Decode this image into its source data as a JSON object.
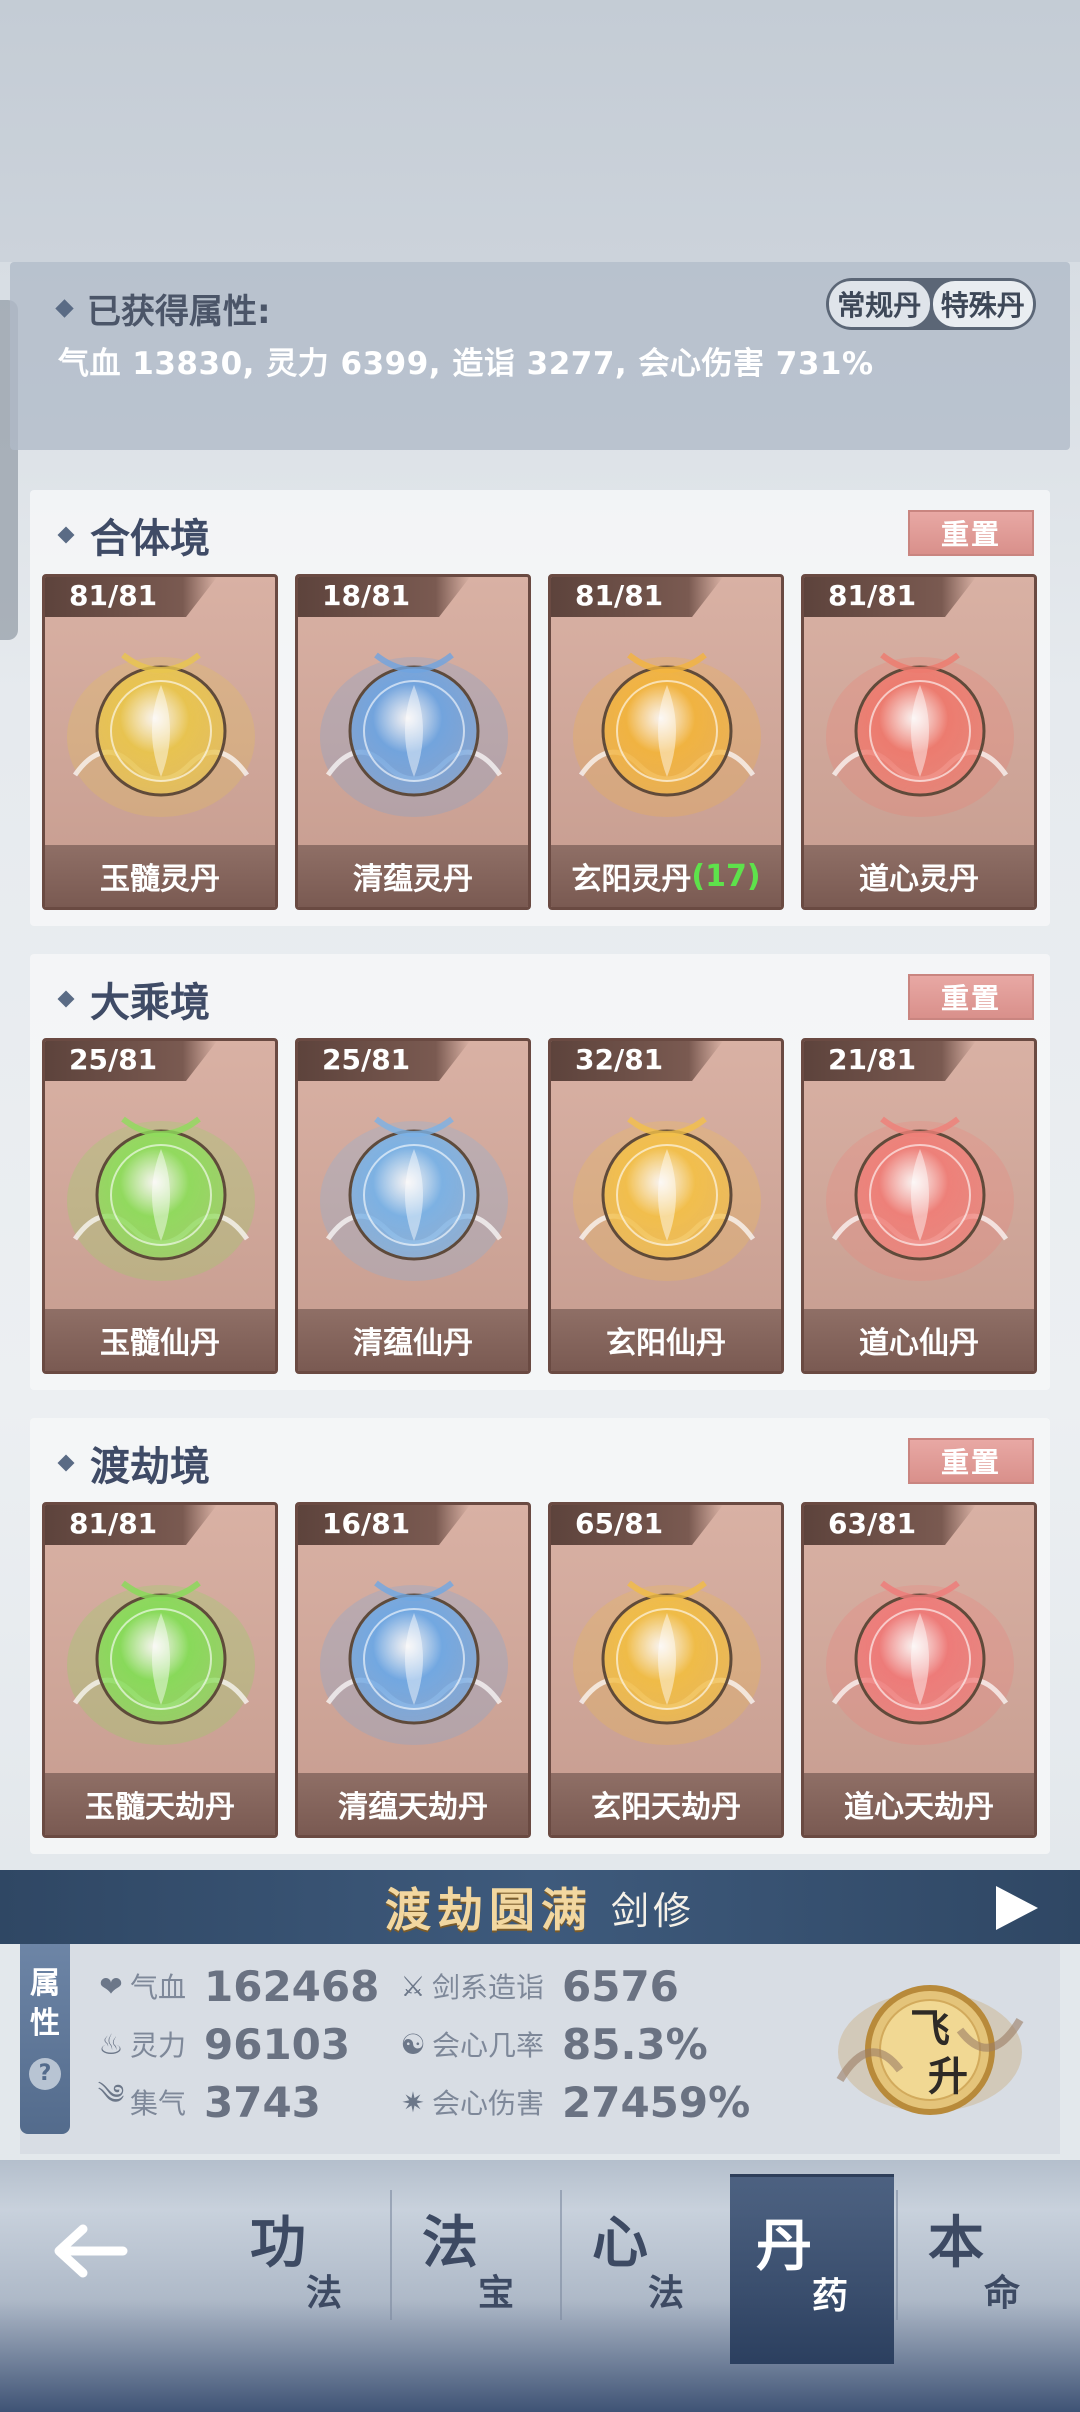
{
  "attributes_header": {
    "title": "已获得属性:",
    "summary": "气血 13830, 灵力 6399, 造诣 3277, 会心伤害 731%",
    "toggle": {
      "regular": "常规丹",
      "special": "特殊丹",
      "selected": "常规丹"
    }
  },
  "realms": [
    {
      "title": "合体境",
      "reset_label": "重置",
      "pills": [
        {
          "count": "81/81",
          "name": "玉髓灵丹",
          "bonus": "",
          "color": "#e9c54e"
        },
        {
          "count": "18/81",
          "name": "清蕴灵丹",
          "bonus": "",
          "color": "#6fa4e0"
        },
        {
          "count": "81/81",
          "name": "玄阳灵丹",
          "bonus": "(17)",
          "color": "#f2b43e"
        },
        {
          "count": "81/81",
          "name": "道心灵丹",
          "bonus": "",
          "color": "#ee7a6e"
        }
      ]
    },
    {
      "title": "大乘境",
      "reset_label": "重置",
      "pills": [
        {
          "count": "25/81",
          "name": "玉髓仙丹",
          "bonus": "",
          "color": "#8fdc5c"
        },
        {
          "count": "25/81",
          "name": "清蕴仙丹",
          "bonus": "",
          "color": "#7ab2e6"
        },
        {
          "count": "32/81",
          "name": "玄阳仙丹",
          "bonus": "",
          "color": "#f3c04a"
        },
        {
          "count": "21/81",
          "name": "道心仙丹",
          "bonus": "",
          "color": "#ef7f78"
        }
      ]
    },
    {
      "title": "渡劫境",
      "reset_label": "重置",
      "pills": [
        {
          "count": "81/81",
          "name": "玉髓天劫丹",
          "bonus": "",
          "color": "#86dc58"
        },
        {
          "count": "16/81",
          "name": "清蕴天劫丹",
          "bonus": "",
          "color": "#6fa8e4"
        },
        {
          "count": "65/81",
          "name": "玄阳天劫丹",
          "bonus": "",
          "color": "#f1bd45"
        },
        {
          "count": "63/81",
          "name": "道心天劫丹",
          "bonus": "",
          "color": "#ef7a78"
        }
      ]
    }
  ],
  "banner": {
    "title": "渡劫圆满",
    "subtitle": "剑修"
  },
  "stats": {
    "tab_label_1": "属",
    "tab_label_2": "性",
    "help": "?",
    "items": [
      {
        "icon": "heart-icon",
        "name": "气血",
        "value": "162468"
      },
      {
        "icon": "flame-icon",
        "name": "灵力",
        "value": "96103"
      },
      {
        "icon": "swirl-icon",
        "name": "集气",
        "value": "3743"
      },
      {
        "icon": "sword-icon",
        "name": "剑系造诣",
        "value": "6576"
      },
      {
        "icon": "crit-rate-icon",
        "name": "会心几率",
        "value": "85.3%"
      },
      {
        "icon": "burst-icon",
        "name": "会心伤害",
        "value": "27459%"
      }
    ],
    "ascend_label_1": "飞",
    "ascend_label_2": "升"
  },
  "nav": {
    "items": [
      {
        "big": "功",
        "small": "法",
        "active": false
      },
      {
        "big": "法",
        "small": "宝",
        "active": false
      },
      {
        "big": "心",
        "small": "法",
        "active": false
      },
      {
        "big": "丹",
        "small": "药",
        "active": true
      },
      {
        "big": "本",
        "small": "命",
        "active": false
      }
    ]
  },
  "colors": {
    "accent_blue": "#3e5a7c",
    "reset_pink": "#e8a8a4",
    "bonus_green": "#5ee24b",
    "banner_gold": "#f2d7a0"
  }
}
